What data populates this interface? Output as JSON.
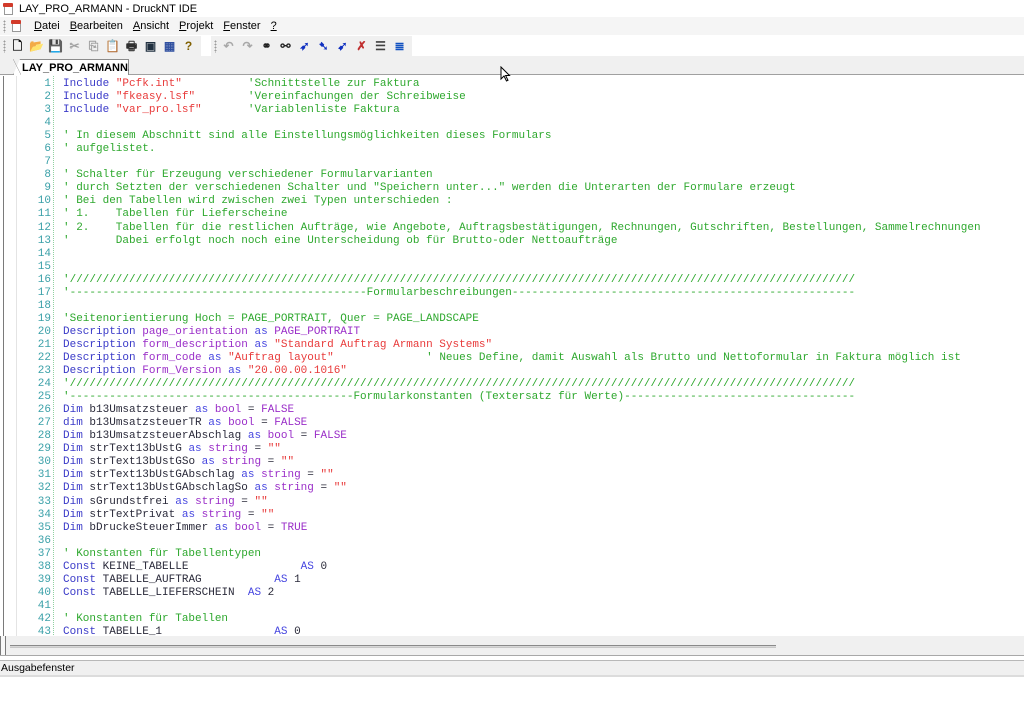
{
  "window": {
    "title": "LAY_PRO_ARMANN - DruckNT IDE",
    "icon": "druck-app-icon"
  },
  "menu": {
    "items": [
      {
        "label_u": "D",
        "label_rest": "atei"
      },
      {
        "label_u": "B",
        "label_rest": "earbeiten"
      },
      {
        "label_u": "A",
        "label_rest": "nsicht"
      },
      {
        "label_u": "P",
        "label_rest": "rojekt"
      },
      {
        "label_u": "F",
        "label_rest": "enster"
      },
      {
        "label_u": "?",
        "label_rest": ""
      }
    ]
  },
  "toolbar": {
    "group1": [
      {
        "name": "new-document-icon",
        "glyph": "🗋",
        "color": "#000000",
        "enabled": true
      },
      {
        "name": "open-folder-icon",
        "glyph": "📂",
        "color": "#c08a20",
        "enabled": true
      },
      {
        "name": "save-icon",
        "glyph": "💾",
        "color": "#203060",
        "enabled": true
      },
      {
        "name": "cut-icon",
        "glyph": "✂",
        "color": "#a0a0a0",
        "enabled": false
      },
      {
        "name": "copy-icon",
        "glyph": "⎘",
        "color": "#a0a0a0",
        "enabled": false
      },
      {
        "name": "paste-icon",
        "glyph": "📋",
        "color": "#305080",
        "enabled": true
      },
      {
        "name": "print-icon",
        "glyph": "🖶",
        "color": "#303030",
        "enabled": true
      },
      {
        "name": "preview-icon",
        "glyph": "▣",
        "color": "#203040",
        "enabled": true
      },
      {
        "name": "calendar-grid-icon",
        "glyph": "▦",
        "color": "#3050a0",
        "enabled": true
      },
      {
        "name": "help-icon",
        "glyph": "?",
        "color": "#806000",
        "enabled": true
      }
    ],
    "group2": [
      {
        "name": "undo-icon",
        "glyph": "↶",
        "color": "#a8a8a8",
        "enabled": false
      },
      {
        "name": "redo-icon",
        "glyph": "↷",
        "color": "#a8a8a8",
        "enabled": false
      },
      {
        "name": "find-binoculars-icon",
        "glyph": "⚭",
        "color": "#202020",
        "enabled": true
      },
      {
        "name": "find-replace-icon",
        "glyph": "⚯",
        "color": "#202020",
        "enabled": true
      },
      {
        "name": "goto-arrow-icon",
        "glyph": "➶",
        "color": "#1030c0",
        "enabled": true
      },
      {
        "name": "bookmark-next-icon",
        "glyph": "➷",
        "color": "#1030c0",
        "enabled": true
      },
      {
        "name": "bookmark-prev-icon",
        "glyph": "➹",
        "color": "#1030c0",
        "enabled": true
      },
      {
        "name": "bookmark-clear-icon",
        "glyph": "✗",
        "color": "#c03030",
        "enabled": true
      },
      {
        "name": "outline-list-icon",
        "glyph": "☰",
        "color": "#404040",
        "enabled": true
      },
      {
        "name": "indent-list-icon",
        "glyph": "≣",
        "color": "#1050c0",
        "enabled": true
      }
    ]
  },
  "tabs": [
    {
      "label": "LAY_PRO_ARMANN.usf",
      "active": true
    }
  ],
  "editor": {
    "lines": [
      {
        "n": "1",
        "t": [
          [
            "kw",
            "Include"
          ],
          [
            "txt",
            " "
          ],
          [
            "str",
            "\"Pcfk.int\""
          ],
          [
            "txt",
            "          "
          ],
          [
            "cm",
            "'Schnittstelle zur Faktura"
          ]
        ]
      },
      {
        "n": "2",
        "t": [
          [
            "kw",
            "Include"
          ],
          [
            "txt",
            " "
          ],
          [
            "str",
            "\"fkeasy.lsf\""
          ],
          [
            "txt",
            "        "
          ],
          [
            "cm",
            "'Vereinfachungen der Schreibweise"
          ]
        ]
      },
      {
        "n": "3",
        "t": [
          [
            "kw",
            "Include"
          ],
          [
            "txt",
            " "
          ],
          [
            "str",
            "\"var_pro.lsf\""
          ],
          [
            "txt",
            "       "
          ],
          [
            "cm",
            "'Variablenliste Faktura"
          ]
        ]
      },
      {
        "n": "4",
        "t": []
      },
      {
        "n": "5",
        "t": [
          [
            "cm",
            "' In diesem Abschnitt sind alle Einstellungsmöglichkeiten dieses Formulars"
          ]
        ]
      },
      {
        "n": "6",
        "t": [
          [
            "cm",
            "' aufgelistet."
          ]
        ]
      },
      {
        "n": "7",
        "t": []
      },
      {
        "n": "8",
        "t": [
          [
            "cm",
            "' Schalter für Erzeugung verschiedener Formularvarianten"
          ]
        ]
      },
      {
        "n": "9",
        "t": [
          [
            "cm",
            "' durch Setzten der verschiedenen Schalter und \"Speichern unter...\" werden die Unterarten der Formulare erzeugt"
          ]
        ]
      },
      {
        "n": "10",
        "t": [
          [
            "cm",
            "' Bei den Tabellen wird zwischen zwei Typen unterschieden :"
          ]
        ]
      },
      {
        "n": "11",
        "t": [
          [
            "cm",
            "' 1.    Tabellen für Lieferscheine"
          ]
        ]
      },
      {
        "n": "12",
        "t": [
          [
            "cm",
            "' 2.    Tabellen für die restlichen Aufträge, wie Angebote, Auftragsbestätigungen, Rechnungen, Gutschriften, Bestellungen, Sammelrechnungen"
          ]
        ]
      },
      {
        "n": "13",
        "t": [
          [
            "cm",
            "'       Dabei erfolgt noch noch eine Unterscheidung ob für Brutto-oder Nettoaufträge"
          ]
        ]
      },
      {
        "n": "14",
        "t": []
      },
      {
        "n": "15",
        "t": []
      },
      {
        "n": "16",
        "t": [
          [
            "cm",
            "'///////////////////////////////////////////////////////////////////////////////////////////////////////////////////////"
          ]
        ]
      },
      {
        "n": "17",
        "t": [
          [
            "cm",
            "'---------------------------------------------Formularbeschreibungen----------------------------------------------------"
          ]
        ]
      },
      {
        "n": "18",
        "t": []
      },
      {
        "n": "19",
        "t": [
          [
            "cm",
            "'Seitenorientierung Hoch = PAGE_PORTRAIT, Quer = PAGE_LANDSCAPE"
          ]
        ]
      },
      {
        "n": "20",
        "t": [
          [
            "kw",
            "Description"
          ],
          [
            "txt",
            " "
          ],
          [
            "ty",
            "page_orientation"
          ],
          [
            "txt",
            " "
          ],
          [
            "as",
            "as"
          ],
          [
            "txt",
            " "
          ],
          [
            "ty",
            "PAGE_PORTRAIT"
          ]
        ]
      },
      {
        "n": "21",
        "t": [
          [
            "kw",
            "Description"
          ],
          [
            "txt",
            " "
          ],
          [
            "ty",
            "form_description"
          ],
          [
            "txt",
            " "
          ],
          [
            "as",
            "as"
          ],
          [
            "txt",
            " "
          ],
          [
            "str",
            "\"Standard Auftrag Armann Systems\""
          ]
        ]
      },
      {
        "n": "22",
        "t": [
          [
            "kw",
            "Description"
          ],
          [
            "txt",
            " "
          ],
          [
            "ty",
            "form_code"
          ],
          [
            "txt",
            " "
          ],
          [
            "as",
            "as"
          ],
          [
            "txt",
            " "
          ],
          [
            "str",
            "\"Auftrag layout\""
          ],
          [
            "txt",
            "              "
          ],
          [
            "cm",
            "' Neues Define, damit Auswahl als Brutto und Nettoformular in Faktura möglich ist"
          ]
        ]
      },
      {
        "n": "23",
        "t": [
          [
            "kw",
            "Description"
          ],
          [
            "txt",
            " "
          ],
          [
            "ty",
            "Form_Version"
          ],
          [
            "txt",
            " "
          ],
          [
            "as",
            "as"
          ],
          [
            "txt",
            " "
          ],
          [
            "str",
            "\"20.00.00.1016\""
          ]
        ]
      },
      {
        "n": "24",
        "t": [
          [
            "cm",
            "'///////////////////////////////////////////////////////////////////////////////////////////////////////////////////////"
          ]
        ]
      },
      {
        "n": "25",
        "t": [
          [
            "cm",
            "'-------------------------------------------Formularkonstanten (Textersatz für Werte)-----------------------------------"
          ]
        ]
      },
      {
        "n": "26",
        "t": [
          [
            "kw",
            "Dim"
          ],
          [
            "txt",
            " "
          ],
          [
            "id",
            "b13Umsatzsteuer"
          ],
          [
            "txt",
            " "
          ],
          [
            "as",
            "as"
          ],
          [
            "txt",
            " "
          ],
          [
            "ty",
            "bool"
          ],
          [
            "txt",
            " = "
          ],
          [
            "ty",
            "FALSE"
          ]
        ]
      },
      {
        "n": "27",
        "t": [
          [
            "kw",
            "dim"
          ],
          [
            "txt",
            " "
          ],
          [
            "id",
            "b13UmsatzsteuerTR"
          ],
          [
            "txt",
            " "
          ],
          [
            "as",
            "as"
          ],
          [
            "txt",
            " "
          ],
          [
            "ty",
            "bool"
          ],
          [
            "txt",
            " = "
          ],
          [
            "ty",
            "FALSE"
          ]
        ]
      },
      {
        "n": "28",
        "t": [
          [
            "kw",
            "Dim"
          ],
          [
            "txt",
            " "
          ],
          [
            "id",
            "b13UmsatzsteuerAbschlag"
          ],
          [
            "txt",
            " "
          ],
          [
            "as",
            "as"
          ],
          [
            "txt",
            " "
          ],
          [
            "ty",
            "bool"
          ],
          [
            "txt",
            " = "
          ],
          [
            "ty",
            "FALSE"
          ]
        ]
      },
      {
        "n": "29",
        "t": [
          [
            "kw",
            "Dim"
          ],
          [
            "txt",
            " "
          ],
          [
            "id",
            "strText13bUstG"
          ],
          [
            "txt",
            " "
          ],
          [
            "as",
            "as"
          ],
          [
            "txt",
            " "
          ],
          [
            "ty",
            "string"
          ],
          [
            "txt",
            " = "
          ],
          [
            "str",
            "\"\""
          ]
        ]
      },
      {
        "n": "30",
        "t": [
          [
            "kw",
            "Dim"
          ],
          [
            "txt",
            " "
          ],
          [
            "id",
            "strText13bUstGSo"
          ],
          [
            "txt",
            " "
          ],
          [
            "as",
            "as"
          ],
          [
            "txt",
            " "
          ],
          [
            "ty",
            "string"
          ],
          [
            "txt",
            " = "
          ],
          [
            "str",
            "\"\""
          ]
        ]
      },
      {
        "n": "31",
        "t": [
          [
            "kw",
            "Dim"
          ],
          [
            "txt",
            " "
          ],
          [
            "id",
            "strText13bUstGAbschlag"
          ],
          [
            "txt",
            " "
          ],
          [
            "as",
            "as"
          ],
          [
            "txt",
            " "
          ],
          [
            "ty",
            "string"
          ],
          [
            "txt",
            " = "
          ],
          [
            "str",
            "\"\""
          ]
        ]
      },
      {
        "n": "32",
        "t": [
          [
            "kw",
            "Dim"
          ],
          [
            "txt",
            " "
          ],
          [
            "id",
            "strText13bUstGAbschlagSo"
          ],
          [
            "txt",
            " "
          ],
          [
            "as",
            "as"
          ],
          [
            "txt",
            " "
          ],
          [
            "ty",
            "string"
          ],
          [
            "txt",
            " = "
          ],
          [
            "str",
            "\"\""
          ]
        ]
      },
      {
        "n": "33",
        "t": [
          [
            "kw",
            "Dim"
          ],
          [
            "txt",
            " "
          ],
          [
            "id",
            "sGrundstfrei"
          ],
          [
            "txt",
            " "
          ],
          [
            "as",
            "as"
          ],
          [
            "txt",
            " "
          ],
          [
            "ty",
            "string"
          ],
          [
            "txt",
            " = "
          ],
          [
            "str",
            "\"\""
          ]
        ]
      },
      {
        "n": "34",
        "t": [
          [
            "kw",
            "Dim"
          ],
          [
            "txt",
            " "
          ],
          [
            "id",
            "strTextPrivat"
          ],
          [
            "txt",
            " "
          ],
          [
            "as",
            "as"
          ],
          [
            "txt",
            " "
          ],
          [
            "ty",
            "string"
          ],
          [
            "txt",
            " = "
          ],
          [
            "str",
            "\"\""
          ]
        ]
      },
      {
        "n": "35",
        "t": [
          [
            "kw",
            "Dim"
          ],
          [
            "txt",
            " "
          ],
          [
            "id",
            "bDruckeSteuerImmer"
          ],
          [
            "txt",
            " "
          ],
          [
            "as",
            "as"
          ],
          [
            "txt",
            " "
          ],
          [
            "ty",
            "bool"
          ],
          [
            "txt",
            " = "
          ],
          [
            "ty",
            "TRUE"
          ]
        ]
      },
      {
        "n": "36",
        "t": []
      },
      {
        "n": "37",
        "t": [
          [
            "cm",
            "' Konstanten für Tabellentypen"
          ]
        ]
      },
      {
        "n": "38",
        "t": [
          [
            "kw",
            "Const"
          ],
          [
            "txt",
            " "
          ],
          [
            "id",
            "KEINE_TABELLE"
          ],
          [
            "txt",
            "                 "
          ],
          [
            "as",
            "AS"
          ],
          [
            "txt",
            " 0"
          ]
        ]
      },
      {
        "n": "39",
        "t": [
          [
            "kw",
            "Const"
          ],
          [
            "txt",
            " "
          ],
          [
            "id",
            "TABELLE_AUFTRAG"
          ],
          [
            "txt",
            "           "
          ],
          [
            "as",
            "AS"
          ],
          [
            "txt",
            " 1"
          ]
        ]
      },
      {
        "n": "40",
        "t": [
          [
            "kw",
            "Const"
          ],
          [
            "txt",
            " "
          ],
          [
            "id",
            "TABELLE_LIEFERSCHEIN"
          ],
          [
            "txt",
            "  "
          ],
          [
            "as",
            "AS"
          ],
          [
            "txt",
            " 2"
          ]
        ]
      },
      {
        "n": "41",
        "t": []
      },
      {
        "n": "42",
        "t": [
          [
            "cm",
            "' Konstanten für Tabellen"
          ]
        ]
      },
      {
        "n": "43",
        "t": [
          [
            "kw",
            "Const"
          ],
          [
            "txt",
            " "
          ],
          [
            "id",
            "TABELLE_1"
          ],
          [
            "txt",
            "                 "
          ],
          [
            "as",
            "AS"
          ],
          [
            "txt",
            " 0"
          ]
        ]
      }
    ]
  },
  "output_pane": {
    "title": "Ausgabefenster"
  }
}
